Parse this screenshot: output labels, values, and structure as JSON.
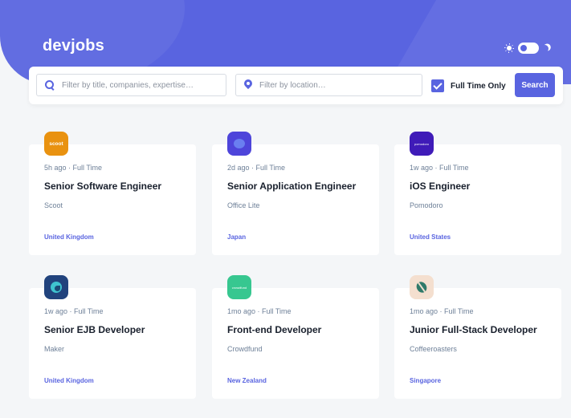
{
  "header": {
    "logo": "devjobs",
    "colors": {
      "brand": "#5964e0",
      "background": "#f4f6f8",
      "text": "#19202d",
      "muted": "#6e8098"
    },
    "theme_toggle": {
      "light_icon": "sun-icon",
      "dark_icon": "moon-icon",
      "mode": "light"
    }
  },
  "search": {
    "title_placeholder": "Filter by title, companies, expertise…",
    "title_value": "",
    "location_placeholder": "Filter by location…",
    "location_value": "",
    "fulltime_label": "Full Time Only",
    "fulltime_checked": true,
    "button_label": "Search"
  },
  "jobs": [
    {
      "posted": "5h ago",
      "contract": "Full Time",
      "meta": "5h ago · Full Time",
      "title": "Senior Software Engineer",
      "company": "Scoot",
      "location": "United Kingdom",
      "logo_text": "scoot",
      "logo_color": "#e99210"
    },
    {
      "posted": "2d ago",
      "contract": "Full Time",
      "meta": "2d ago · Full Time",
      "title": "Senior Application Engineer",
      "company": "Office Lite",
      "location": "Japan",
      "logo_text": "",
      "logo_color": "#4e45da"
    },
    {
      "posted": "1w ago",
      "contract": "Full Time",
      "meta": "1w ago · Full Time",
      "title": "iOS Engineer",
      "company": "Pomodoro",
      "location": "United States",
      "logo_text": "pomodoro",
      "logo_color": "#3f1bb8"
    },
    {
      "posted": "1w ago",
      "contract": "Full Time",
      "meta": "1w ago · Full Time",
      "title": "Senior EJB Developer",
      "company": "Maker",
      "location": "United Kingdom",
      "logo_text": "",
      "logo_color": "#21437d"
    },
    {
      "posted": "1mo ago",
      "contract": "Full Time",
      "meta": "1mo ago · Full Time",
      "title": "Front-end Developer",
      "company": "Crowdfund",
      "location": "New Zealand",
      "logo_text": "crowdfund",
      "logo_color": "#37c790"
    },
    {
      "posted": "1mo ago",
      "contract": "Full Time",
      "meta": "1mo ago · Full Time",
      "title": "Junior Full-Stack Developer",
      "company": "Coffeeroasters",
      "location": "Singapore",
      "logo_text": "",
      "logo_color": "#f4dfcf"
    }
  ]
}
